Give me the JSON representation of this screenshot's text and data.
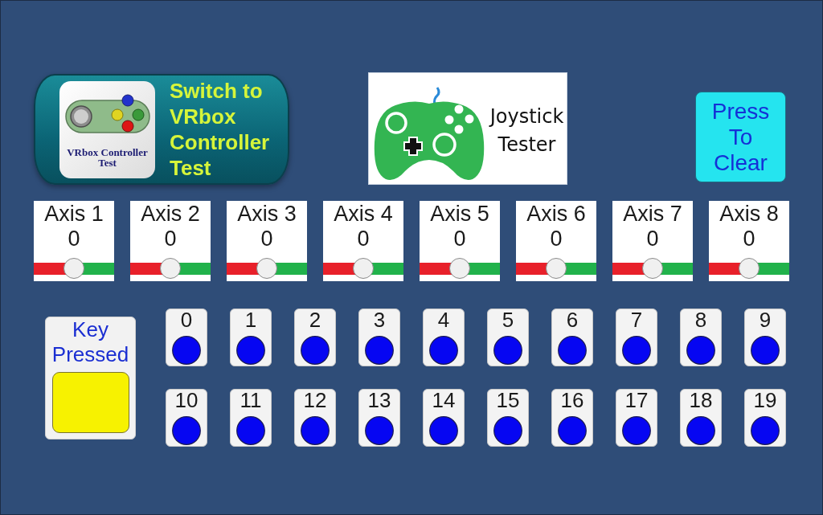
{
  "switch_button": {
    "label": "Switch to VRbox Controller Test",
    "logo_caption": "VRbox Controller Test"
  },
  "app_logo": {
    "text": "Joystick Tester"
  },
  "clear_button": {
    "label": "Press To Clear"
  },
  "axes": [
    {
      "label": "Axis 1",
      "value": "0",
      "level": 0.5
    },
    {
      "label": "Axis 2",
      "value": "0",
      "level": 0.5
    },
    {
      "label": "Axis 3",
      "value": "0",
      "level": 0.5
    },
    {
      "label": "Axis 4",
      "value": "0",
      "level": 0.5
    },
    {
      "label": "Axis 5",
      "value": "0",
      "level": 0.5
    },
    {
      "label": "Axis 6",
      "value": "0",
      "level": 0.5
    },
    {
      "label": "Axis 7",
      "value": "0",
      "level": 0.5
    },
    {
      "label": "Axis 8",
      "value": "0",
      "level": 0.5
    }
  ],
  "key_pressed": {
    "label": "Key Pressed"
  },
  "keys": [
    {
      "label": "0"
    },
    {
      "label": "1"
    },
    {
      "label": "2"
    },
    {
      "label": "3"
    },
    {
      "label": "4"
    },
    {
      "label": "5"
    },
    {
      "label": "6"
    },
    {
      "label": "7"
    },
    {
      "label": "8"
    },
    {
      "label": "9"
    },
    {
      "label": "10"
    },
    {
      "label": "11"
    },
    {
      "label": "12"
    },
    {
      "label": "13"
    },
    {
      "label": "14"
    },
    {
      "label": "15"
    },
    {
      "label": "16"
    },
    {
      "label": "17"
    },
    {
      "label": "18"
    },
    {
      "label": "19"
    }
  ]
}
